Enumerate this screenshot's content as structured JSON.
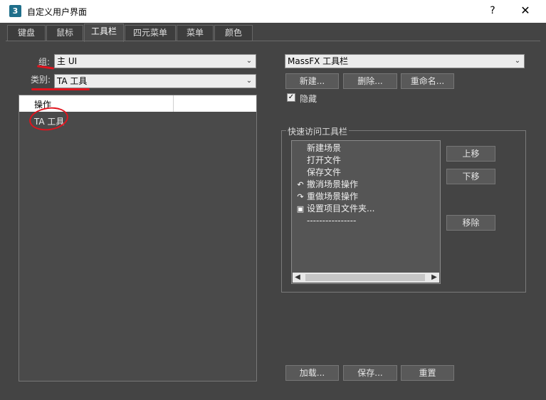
{
  "window": {
    "title": "自定义用户界面",
    "help_label": "?",
    "close_label": "✕",
    "icon_name": "3dsmax-app-icon"
  },
  "tabs": [
    {
      "label": "键盘"
    },
    {
      "label": "鼠标"
    },
    {
      "label": "工具栏"
    },
    {
      "label": "四元菜单"
    },
    {
      "label": "菜单"
    },
    {
      "label": "颜色"
    }
  ],
  "active_tab": "工具栏",
  "left": {
    "group_label": "组:",
    "group_value": "主 UI",
    "category_label": "类别:",
    "category_value": "TA 工具",
    "actions_header": "操作",
    "actions": [
      "TA 工具"
    ]
  },
  "right": {
    "toolbar_select_value": "MassFX 工具栏",
    "new_button": "新建...",
    "delete_button": "删除...",
    "rename_button": "重命名...",
    "hide_label": "隐藏",
    "hide_checked": true,
    "quick_access_title": "快速访问工具栏",
    "quick_access_items": [
      {
        "label": "新建场景",
        "icon": ""
      },
      {
        "label": "打开文件",
        "icon": ""
      },
      {
        "label": "保存文件",
        "icon": ""
      },
      {
        "label": "撤消场景操作",
        "icon": "undo-icon"
      },
      {
        "label": "重做场景操作",
        "icon": "redo-icon"
      },
      {
        "label": "设置项目文件夹...",
        "icon": "project-folder-icon"
      },
      {
        "label": "----------------",
        "icon": ""
      }
    ],
    "move_up_button": "上移",
    "move_down_button": "下移",
    "remove_button": "移除"
  },
  "bottom": {
    "load_button": "加载...",
    "save_button": "保存...",
    "reset_button": "重置"
  },
  "colors": {
    "annotation_red": "#e0141e",
    "panel_bg": "#444444"
  }
}
